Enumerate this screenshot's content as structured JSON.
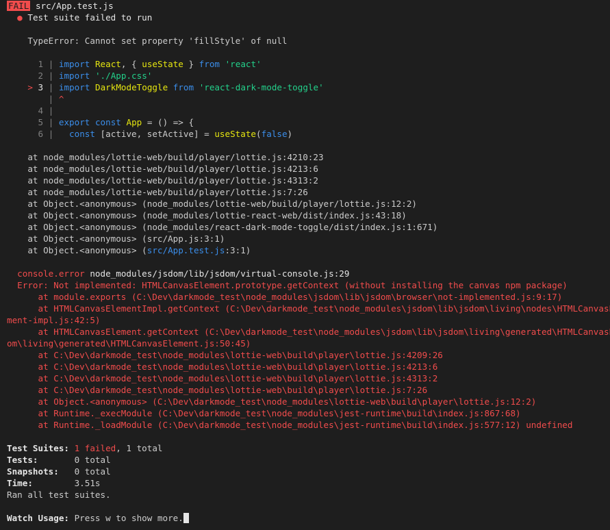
{
  "header": {
    "badge": "FAIL",
    "file": "src/App.test.js"
  },
  "summary_line": "Test suite failed to run",
  "bullet": "●",
  "error_message": "TypeError: Cannot set property 'fillStyle' of null",
  "code": {
    "marker": ">",
    "caret": "^",
    "separator": "|",
    "lines": [
      {
        "num": "1",
        "kw": "import",
        "ident": "React",
        "rest1": ", { ",
        "ident2": "useState",
        "rest2": " } ",
        "kw2": "from",
        "str": "'react'"
      },
      {
        "num": "2",
        "kw": "import",
        "str": "'./App.css'"
      },
      {
        "num": "3",
        "kw": "import",
        "ident": "DarkModeToggle",
        "kw2": "from",
        "str": "'react-dark-mode-toggle'"
      },
      {
        "num": "4"
      },
      {
        "num": "5",
        "kw": "export",
        "kw_b": "const",
        "ident": "App",
        "rest": " = () => {"
      },
      {
        "num": "6",
        "kw": "const",
        "rest": " [active, setActive] = ",
        "ident": "useState",
        "paren_open": "(",
        "val": "false",
        "paren_close": ")"
      }
    ]
  },
  "stack": [
    "at node_modules/lottie-web/build/player/lottie.js:4210:23",
    "at node_modules/lottie-web/build/player/lottie.js:4213:6",
    "at node_modules/lottie-web/build/player/lottie.js:4313:2",
    "at node_modules/lottie-web/build/player/lottie.js:7:26",
    "at Object.<anonymous> (node_modules/lottie-web/build/player/lottie.js:12:2)",
    "at Object.<anonymous> (node_modules/lottie-react-web/dist/index.js:43:18)",
    "at Object.<anonymous> (node_modules/react-dark-mode-toggle/dist/index.js:1:671)",
    "at Object.<anonymous> (src/App.js:3:1)"
  ],
  "stack_last": {
    "prefix": "at Object.<anonymous> (",
    "link": "src/App.test.js",
    "suffix": ":3:1)"
  },
  "console_error": {
    "label": "console.error",
    "path": "node_modules/jsdom/lib/jsdom/virtual-console.js:29",
    "lines": [
      "  Error: Not implemented: HTMLCanvasElement.prototype.getContext (without installing the canvas npm package)",
      "      at module.exports (C:\\Dev\\darkmode_test\\node_modules\\jsdom\\lib\\jsdom\\browser\\not-implemented.js:9:17)",
      "      at HTMLCanvasElementImpl.getContext (C:\\Dev\\darkmode_test\\node_modules\\jsdom\\lib\\jsdom\\living\\nodes\\HTMLCanvasEle",
      "ment-impl.js:42:5)",
      "      at HTMLCanvasElement.getContext (C:\\Dev\\darkmode_test\\node_modules\\jsdom\\lib\\jsdom\\living\\generated\\HTMLCanvasEle",
      "om\\living\\generated\\HTMLCanvasElement.js:50:45)",
      "      at C:\\Dev\\darkmode_test\\node_modules\\lottie-web\\build\\player\\lottie.js:4209:26",
      "      at C:\\Dev\\darkmode_test\\node_modules\\lottie-web\\build\\player\\lottie.js:4213:6",
      "      at C:\\Dev\\darkmode_test\\node_modules\\lottie-web\\build\\player\\lottie.js:4313:2",
      "      at C:\\Dev\\darkmode_test\\node_modules\\lottie-web\\build\\player\\lottie.js:7:26",
      "      at Object.<anonymous> (C:\\Dev\\darkmode_test\\node_modules\\lottie-web\\build\\player\\lottie.js:12:2)",
      "      at Runtime._execModule (C:\\Dev\\darkmode_test\\node_modules\\jest-runtime\\build\\index.js:867:68)",
      "      at Runtime._loadModule (C:\\Dev\\darkmode_test\\node_modules\\jest-runtime\\build\\index.js:577:12) undefined"
    ]
  },
  "results": {
    "suites_label": "Test Suites:",
    "suites_failed": "1 failed",
    "suites_total": ", 1 total",
    "tests_label": "Tests:",
    "tests_value": "0 total",
    "snapshots_label": "Snapshots:",
    "snapshots_value": "0 total",
    "time_label": "Time:",
    "time_value": "3.51s",
    "ran": "Ran all test suites."
  },
  "watch": {
    "label": "Watch Usage:",
    "text": "Press w to show more."
  }
}
